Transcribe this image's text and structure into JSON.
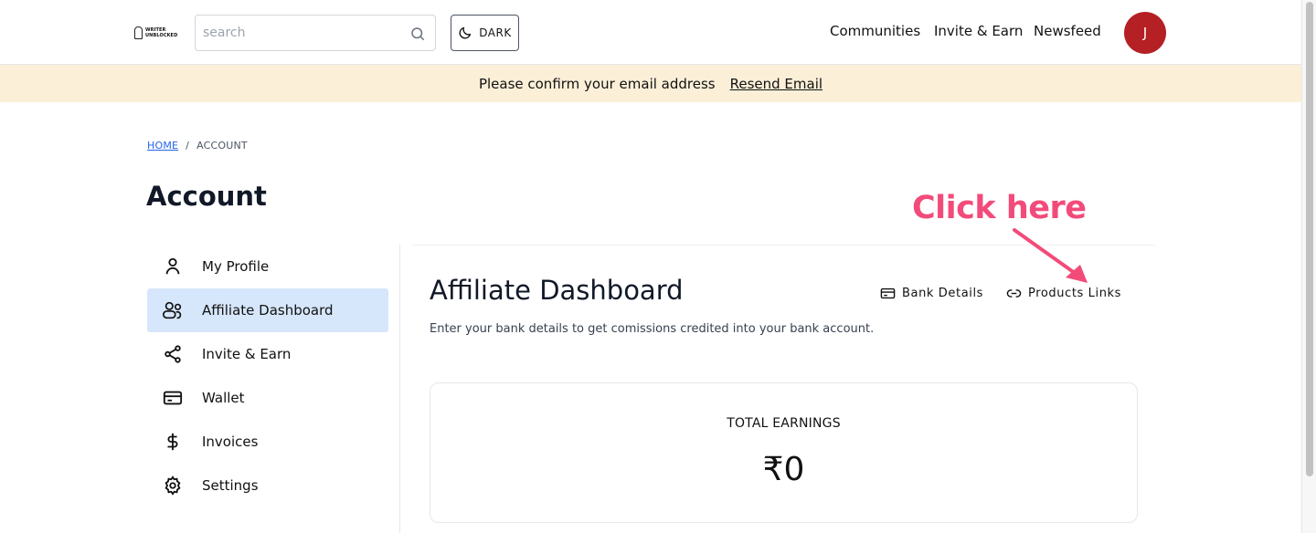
{
  "header": {
    "logo_text_top": "WRITER",
    "logo_text_bottom": "UNBLOCKED",
    "search_placeholder": "search",
    "theme_button": "DARK",
    "nav": [
      "Communities",
      "Invite & Earn",
      "Newsfeed"
    ],
    "avatar_initial": "J",
    "avatar_color": "#b42024"
  },
  "banner": {
    "message": "Please confirm your email address",
    "link": "Resend Email",
    "background": "#fcefd8"
  },
  "breadcrumb": {
    "home": "HOME",
    "separator": "/",
    "current": "ACCOUNT"
  },
  "page_title": "Account",
  "sidebar": {
    "items": [
      {
        "label": "My Profile",
        "icon": "user-icon",
        "active": false
      },
      {
        "label": "Affiliate Dashboard",
        "icon": "users-icon",
        "active": true
      },
      {
        "label": "Invite & Earn",
        "icon": "share-icon",
        "active": false
      },
      {
        "label": "Wallet",
        "icon": "credit-card-icon",
        "active": false
      },
      {
        "label": "Invoices",
        "icon": "dollar-icon",
        "active": false
      },
      {
        "label": "Settings",
        "icon": "gear-icon",
        "active": false
      }
    ]
  },
  "main": {
    "title": "Affiliate Dashboard",
    "tabs": [
      {
        "label": "Bank Details",
        "icon": "credit-card-icon"
      },
      {
        "label": "Products Links",
        "icon": "link-icon"
      }
    ],
    "subtitle": "Enter your bank details to get comissions credited into your bank account.",
    "earnings_label": "TOTAL EARNINGS",
    "earnings_value": "₹0"
  },
  "annotation": {
    "text": "Click here",
    "color": "#f24b7a"
  }
}
